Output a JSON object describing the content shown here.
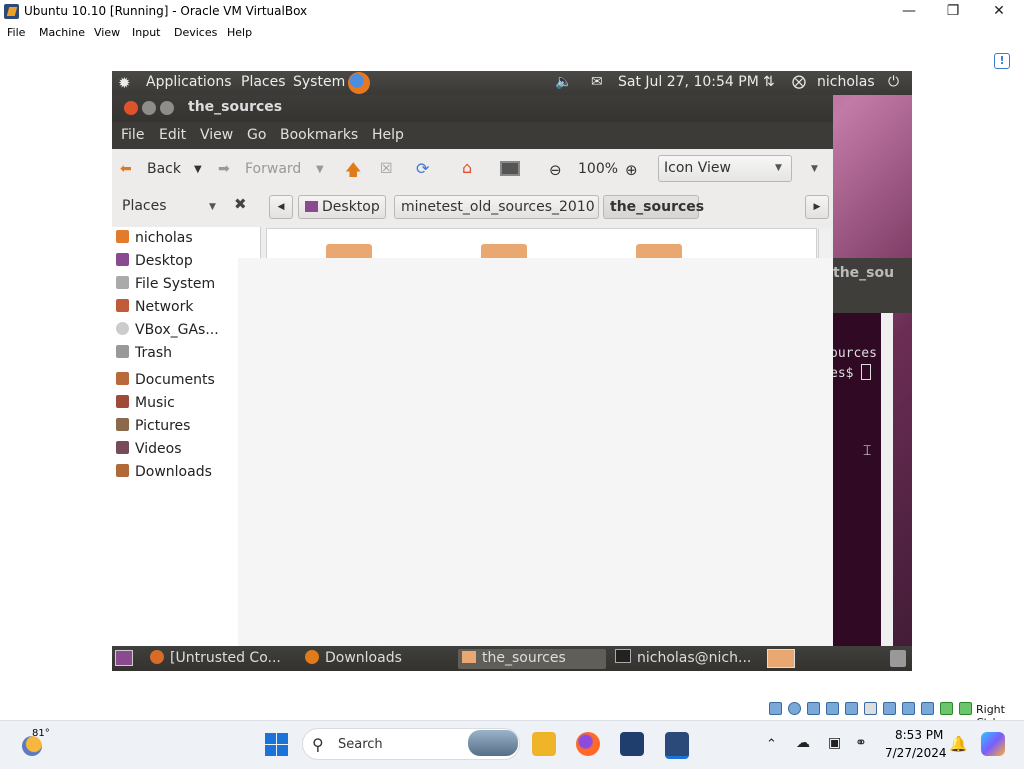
{
  "host_window": {
    "title": "Ubuntu 10.10 [Running] - Oracle VM VirtualBox",
    "menu": [
      "File",
      "Machine",
      "View",
      "Input",
      "Devices",
      "Help"
    ],
    "status_right": "Right Ctrl"
  },
  "guest_panel": {
    "menus": [
      "Applications",
      "Places",
      "System"
    ],
    "datetime": "Sat Jul 27, 10:54 PM",
    "user": "nicholas"
  },
  "nautilus": {
    "title": "the_sources",
    "menu": [
      "File",
      "Edit",
      "View",
      "Go",
      "Bookmarks",
      "Help"
    ],
    "toolbar": {
      "back": "Back",
      "forward": "Forward",
      "zoom": "100%",
      "view_mode": "Icon View"
    },
    "sidebar_header": "Places",
    "breadcrumbs": [
      "Desktop",
      "minetest_old_sources_2010",
      "the_sources"
    ],
    "places": [
      "nicholas",
      "Desktop",
      "File System",
      "Network",
      "VBox_GAs...",
      "Trash"
    ],
    "bookmarks": [
      "Documents",
      "Music",
      "Pictures",
      "Videos",
      "Downloads"
    ]
  },
  "terminal": {
    "title": "the_sourc",
    "lines": [
      "ources",
      "es$"
    ]
  },
  "guest_taskbar": {
    "items": [
      "[Untrusted Co...",
      "Downloads",
      "the_sources",
      "nicholas@nich..."
    ]
  },
  "windows_taskbar": {
    "weather": "81°",
    "search_placeholder": "Search",
    "time": "8:53 PM",
    "date": "7/27/2024"
  }
}
